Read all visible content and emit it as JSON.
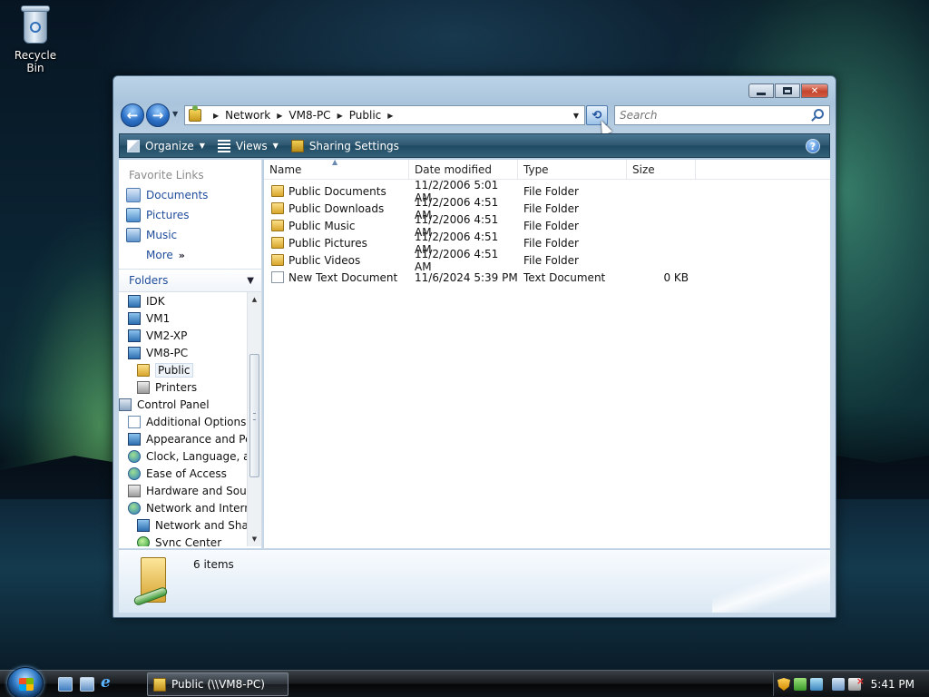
{
  "desktop": {
    "recycle_bin_label": "Recycle Bin"
  },
  "window": {
    "address": {
      "crumbs": [
        "Network",
        "VM8-PC",
        "Public"
      ]
    },
    "search": {
      "placeholder": "Search"
    },
    "toolbar": {
      "organize": "Organize",
      "views": "Views",
      "sharing_settings": "Sharing Settings",
      "help_icon": "?"
    },
    "left_pane": {
      "favorites_title": "Favorite Links",
      "favorites": [
        {
          "label": "Documents",
          "icon": "documents-icon"
        },
        {
          "label": "Pictures",
          "icon": "pictures-icon"
        },
        {
          "label": "Music",
          "icon": "music-icon"
        }
      ],
      "more_label": "More",
      "folders_title": "Folders",
      "tree": [
        {
          "label": "IDK",
          "icon": "computer-icon"
        },
        {
          "label": "VM1",
          "icon": "computer-icon"
        },
        {
          "label": "VM2-XP",
          "icon": "computer-icon"
        },
        {
          "label": "VM8-PC",
          "icon": "computer-icon"
        },
        {
          "label": "Public",
          "icon": "folder-icon",
          "selected": true
        },
        {
          "label": "Printers",
          "icon": "printer-icon"
        },
        {
          "label": "Control Panel",
          "icon": "control-panel-icon"
        },
        {
          "label": "Additional Options",
          "icon": "check-icon"
        },
        {
          "label": "Appearance and Personalization",
          "icon": "display-icon"
        },
        {
          "label": "Clock, Language, and Region",
          "icon": "globe-icon"
        },
        {
          "label": "Ease of Access",
          "icon": "ease-access-icon"
        },
        {
          "label": "Hardware and Sound",
          "icon": "printer-icon"
        },
        {
          "label": "Network and Internet",
          "icon": "network-icon"
        },
        {
          "label": "Network and Sharing Center",
          "icon": "network-icon"
        },
        {
          "label": "Sync Center",
          "icon": "sync-icon"
        }
      ]
    },
    "columns": {
      "name": "Name",
      "date": "Date modified",
      "type": "Type",
      "size": "Size"
    },
    "files": [
      {
        "name": "Public Documents",
        "date": "11/2/2006 5:01 AM",
        "type": "File Folder",
        "size": "",
        "icon": "folder-icon"
      },
      {
        "name": "Public Downloads",
        "date": "11/2/2006 4:51 AM",
        "type": "File Folder",
        "size": "",
        "icon": "folder-icon"
      },
      {
        "name": "Public Music",
        "date": "11/2/2006 4:51 AM",
        "type": "File Folder",
        "size": "",
        "icon": "music-folder-icon"
      },
      {
        "name": "Public Pictures",
        "date": "11/2/2006 4:51 AM",
        "type": "File Folder",
        "size": "",
        "icon": "pictures-folder-icon"
      },
      {
        "name": "Public Videos",
        "date": "11/2/2006 4:51 AM",
        "type": "File Folder",
        "size": "",
        "icon": "videos-folder-icon"
      },
      {
        "name": "New Text Document",
        "date": "11/6/2024 5:39 PM",
        "type": "Text Document",
        "size": "0 KB",
        "icon": "text-document-icon"
      }
    ],
    "details": {
      "item_count": "6 items"
    }
  },
  "taskbar": {
    "task_label": "Public (\\\\VM8-PC)",
    "clock": "5:41 PM"
  }
}
